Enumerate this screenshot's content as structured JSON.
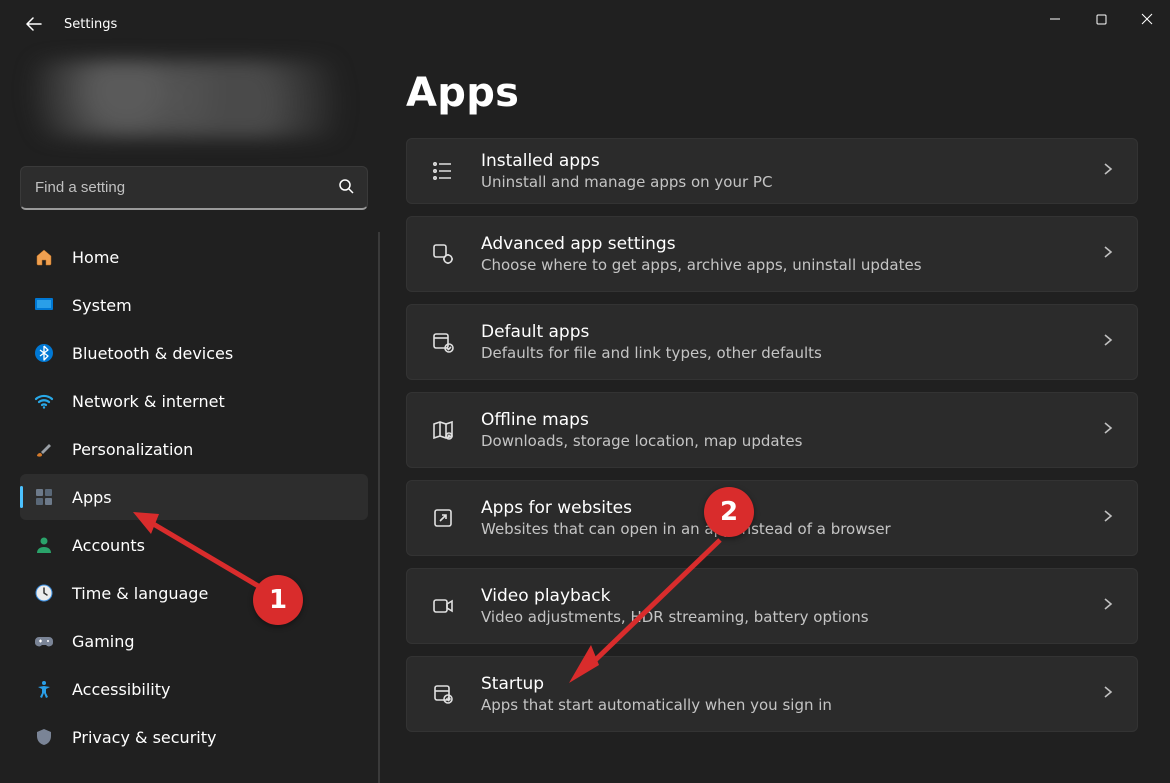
{
  "app": {
    "title": "Settings"
  },
  "search": {
    "placeholder": "Find a setting"
  },
  "nav": {
    "items": [
      {
        "label": "Home",
        "icon": "home"
      },
      {
        "label": "System",
        "icon": "system"
      },
      {
        "label": "Bluetooth & devices",
        "icon": "bluetooth"
      },
      {
        "label": "Network & internet",
        "icon": "wifi"
      },
      {
        "label": "Personalization",
        "icon": "paintbrush"
      },
      {
        "label": "Apps",
        "icon": "apps",
        "active": true
      },
      {
        "label": "Accounts",
        "icon": "person"
      },
      {
        "label": "Time & language",
        "icon": "clock"
      },
      {
        "label": "Gaming",
        "icon": "gamepad"
      },
      {
        "label": "Accessibility",
        "icon": "accessibility"
      },
      {
        "label": "Privacy & security",
        "icon": "shield"
      }
    ]
  },
  "page": {
    "title": "Apps"
  },
  "cards": [
    {
      "title": "Installed apps",
      "desc": "Uninstall and manage apps on your PC",
      "icon": "list"
    },
    {
      "title": "Advanced app settings",
      "desc": "Choose where to get apps, archive apps, uninstall updates",
      "icon": "app-gear"
    },
    {
      "title": "Default apps",
      "desc": "Defaults for file and link types, other defaults",
      "icon": "window-check"
    },
    {
      "title": "Offline maps",
      "desc": "Downloads, storage location, map updates",
      "icon": "map"
    },
    {
      "title": "Apps for websites",
      "desc": "Websites that can open in an app instead of a browser",
      "icon": "open-ext"
    },
    {
      "title": "Video playback",
      "desc": "Video adjustments, HDR streaming, battery options",
      "icon": "video"
    },
    {
      "title": "Startup",
      "desc": "Apps that start automatically when you sign in",
      "icon": "startup"
    }
  ],
  "annotations": {
    "1": "1",
    "2": "2"
  }
}
